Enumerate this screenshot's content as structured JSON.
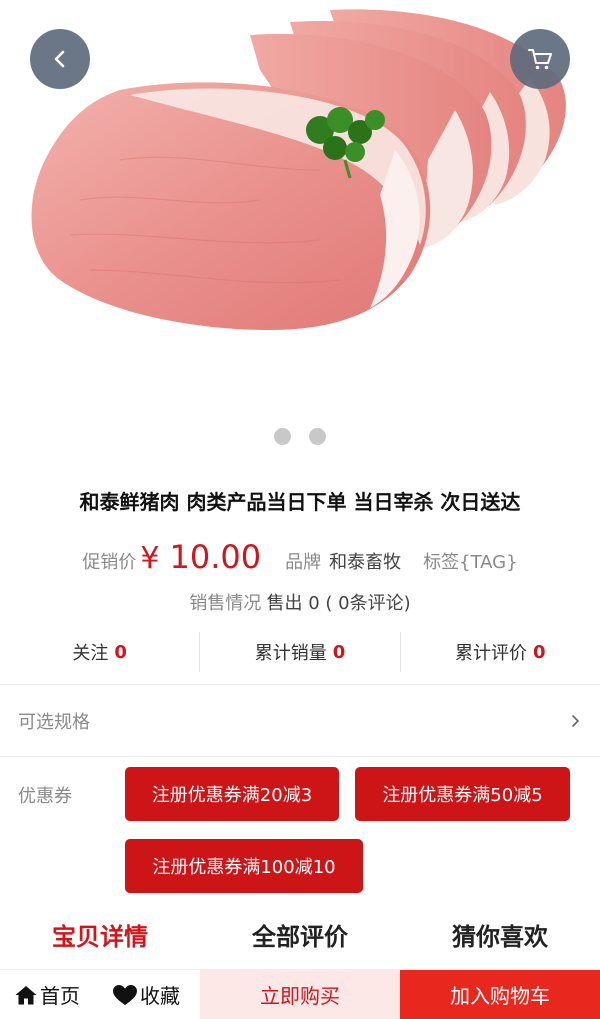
{
  "hero": {
    "image": "pork-chop-slices-with-parsley",
    "back_icon": "chevron-left-icon",
    "cart_icon": "shopping-cart-icon",
    "carousel_count": 2
  },
  "product": {
    "title": "和泰鲜猪肉 肉类产品当日下单 当日宰杀 次日送达",
    "price_label": "促销价",
    "currency": "¥",
    "price": "10.00",
    "brand_label": "品牌",
    "brand_value": "和泰畜牧",
    "tag_label": "标签{TAG}",
    "sales_label": "销售情况",
    "sales_value": "售出 0 ( 0条评论)"
  },
  "stats": [
    {
      "label": "关注",
      "value": "0"
    },
    {
      "label": "累计销量",
      "value": "0"
    },
    {
      "label": "累计评价",
      "value": "0"
    }
  ],
  "spec": {
    "label": "可选规格",
    "icon": "chevron-right-icon"
  },
  "coupons": {
    "label": "优惠券",
    "items": [
      "注册优惠券满20减3",
      "注册优惠券满50减5",
      "注册优惠券满100减10"
    ]
  },
  "tabs": [
    {
      "label": "宝贝详情",
      "active": true
    },
    {
      "label": "全部评价",
      "active": false
    },
    {
      "label": "猜你喜欢",
      "active": false
    }
  ],
  "bottom_bar": {
    "home": "首页",
    "favorite": "收藏",
    "buy_now": "立即购买",
    "add_cart": "加入购物车"
  },
  "colors": {
    "accent": "#d0161b",
    "add_cart_bg": "#e8281f",
    "buy_now_bg": "#fde8e8"
  }
}
